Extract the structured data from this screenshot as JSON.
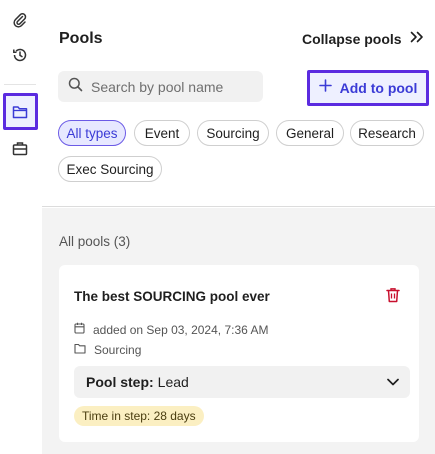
{
  "sidebar": {
    "icons": [
      "paperclip-icon",
      "history-icon",
      "folder-icon",
      "briefcase-icon"
    ],
    "active_color": "#5b2be0"
  },
  "header": {
    "title": "Pools",
    "collapse_label": "Collapse pools"
  },
  "search": {
    "placeholder": "Search by pool name",
    "value": ""
  },
  "actions": {
    "add_label": "Add to pool"
  },
  "filters": {
    "chips": [
      {
        "label": "All types",
        "active": true
      },
      {
        "label": "Event",
        "active": false
      },
      {
        "label": "Sourcing",
        "active": false
      },
      {
        "label": "General",
        "active": false
      },
      {
        "label": "Research",
        "active": false
      },
      {
        "label": "Exec Sourcing",
        "active": false
      }
    ]
  },
  "pools": {
    "heading": "All pools (3)",
    "items": [
      {
        "title": "The best SOURCING pool ever",
        "added": "added on Sep 03, 2024, 7:36 AM",
        "type": "Sourcing",
        "step_label": "Pool step:",
        "step_value": "Lead",
        "time_in_step": "Time in step: 28 days"
      }
    ]
  },
  "colors": {
    "accent": "#3b3bd6",
    "danger": "#c8102e",
    "badge_bg": "#fbefc2"
  }
}
